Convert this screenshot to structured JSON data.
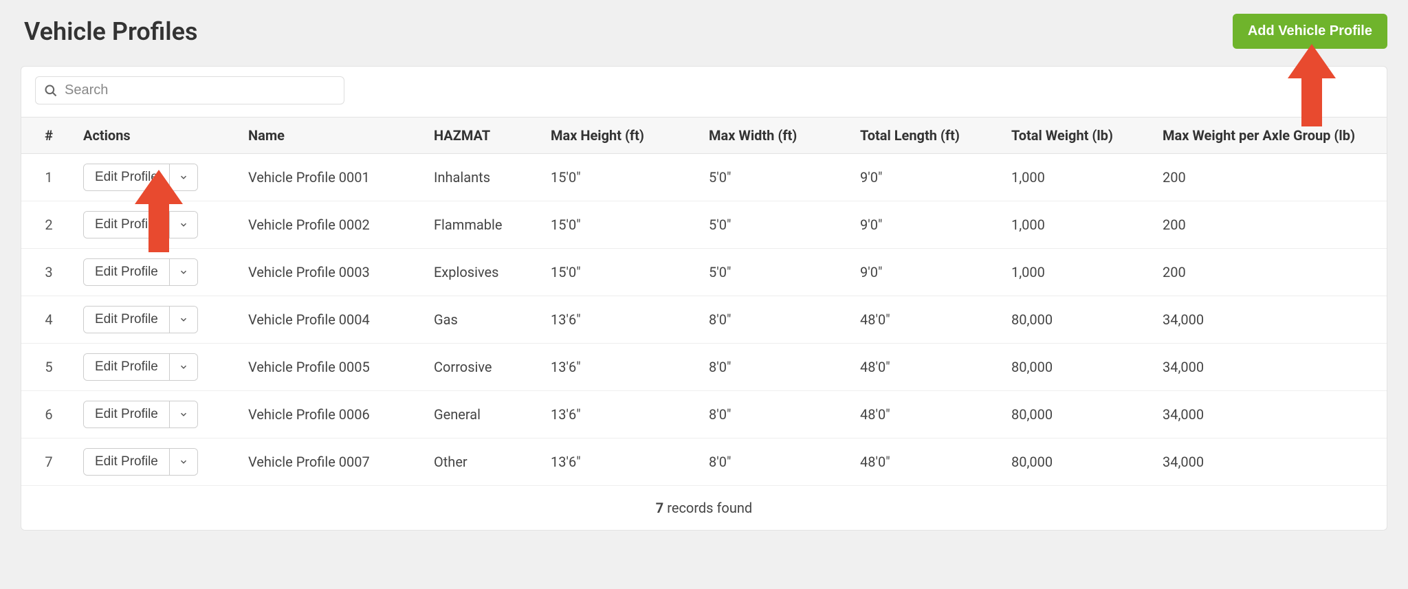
{
  "header": {
    "title": "Vehicle Profiles",
    "add_button": "Add Vehicle Profile"
  },
  "search": {
    "placeholder": "Search",
    "value": ""
  },
  "columns": {
    "num": "#",
    "actions": "Actions",
    "name": "Name",
    "hazmat": "HAZMAT",
    "max_height": "Max Height (ft)",
    "max_width": "Max Width (ft)",
    "total_length": "Total Length (ft)",
    "total_weight": "Total Weight (lb)",
    "max_axle": "Max Weight per Axle Group (lb)"
  },
  "edit_label": "Edit Profile",
  "rows": [
    {
      "num": "1",
      "name": "Vehicle Profile 0001",
      "hazmat": "Inhalants",
      "max_height": "15'0\"",
      "max_width": "5'0\"",
      "total_length": "9'0\"",
      "total_weight": "1,000",
      "max_axle": "200"
    },
    {
      "num": "2",
      "name": "Vehicle Profile 0002",
      "hazmat": "Flammable",
      "max_height": "15'0\"",
      "max_width": "5'0\"",
      "total_length": "9'0\"",
      "total_weight": "1,000",
      "max_axle": "200"
    },
    {
      "num": "3",
      "name": "Vehicle Profile 0003",
      "hazmat": "Explosives",
      "max_height": "15'0\"",
      "max_width": "5'0\"",
      "total_length": "9'0\"",
      "total_weight": "1,000",
      "max_axle": "200"
    },
    {
      "num": "4",
      "name": "Vehicle Profile 0004",
      "hazmat": "Gas",
      "max_height": "13'6\"",
      "max_width": "8'0\"",
      "total_length": "48'0\"",
      "total_weight": "80,000",
      "max_axle": "34,000"
    },
    {
      "num": "5",
      "name": "Vehicle Profile 0005",
      "hazmat": "Corrosive",
      "max_height": "13'6\"",
      "max_width": "8'0\"",
      "total_length": "48'0\"",
      "total_weight": "80,000",
      "max_axle": "34,000"
    },
    {
      "num": "6",
      "name": "Vehicle Profile 0006",
      "hazmat": "General",
      "max_height": "13'6\"",
      "max_width": "8'0\"",
      "total_length": "48'0\"",
      "total_weight": "80,000",
      "max_axle": "34,000"
    },
    {
      "num": "7",
      "name": "Vehicle Profile 0007",
      "hazmat": "Other",
      "max_height": "13'6\"",
      "max_width": "8'0\"",
      "total_length": "48'0\"",
      "total_weight": "80,000",
      "max_axle": "34,000"
    }
  ],
  "footer": {
    "count": "7",
    "suffix": " records found"
  },
  "annotations": {
    "arrow_color": "#e84a2f"
  }
}
